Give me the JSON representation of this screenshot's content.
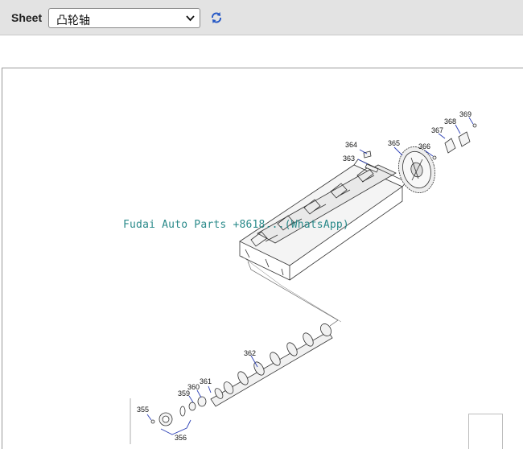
{
  "toolbar": {
    "sheet_label": "Sheet",
    "sheet_value": "凸轮轴",
    "refresh_icon": "refresh-icon"
  },
  "watermark": "Fudai Auto Parts +8618...(WhatsApp)",
  "callouts": {
    "c355": "355",
    "c356": "356",
    "c359": "359",
    "c360": "360",
    "c361": "361",
    "c362": "362",
    "c363": "363",
    "c364": "364",
    "c365": "365",
    "c366": "366",
    "c367": "367",
    "c368": "368",
    "c369": "369"
  },
  "colors": {
    "leader": "#2b3fb5",
    "line": "#333333",
    "toolbar_bg": "#e3e3e3",
    "watermark": "#2a8a8a"
  }
}
